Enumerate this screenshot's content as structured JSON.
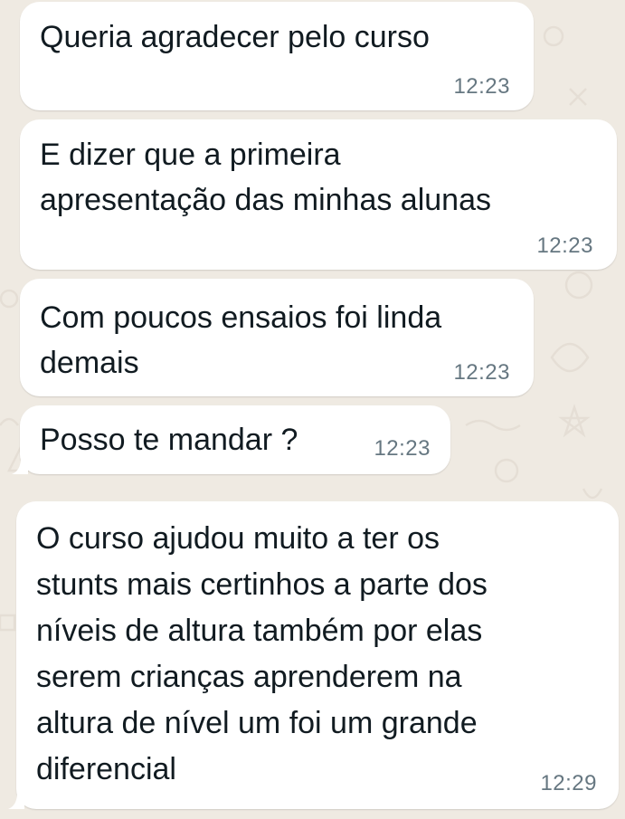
{
  "chat": {
    "messages": [
      {
        "lines": [
          "Queria agradecer pelo curso"
        ],
        "time": "12:23"
      },
      {
        "lines": [
          "E dizer que a primeira",
          "apresentação das minhas alunas"
        ],
        "time": "12:23"
      },
      {
        "lines": [
          "Com poucos ensaios foi linda",
          "demais"
        ],
        "time": "12:23"
      },
      {
        "lines": [
          "Posso te mandar ?"
        ],
        "time": "12:23"
      },
      {
        "lines": [
          "O curso ajudou muito a ter os",
          "stunts mais certinhos a parte dos",
          "níveis de altura também por elas",
          "serem crianças aprenderem na",
          "altura de nível um foi um grande",
          "diferencial"
        ],
        "time": "12:29"
      }
    ]
  },
  "colors": {
    "wallpaper": "#efeae2",
    "bubble": "#ffffff",
    "text": "#111b21",
    "timestamp": "#667781"
  }
}
